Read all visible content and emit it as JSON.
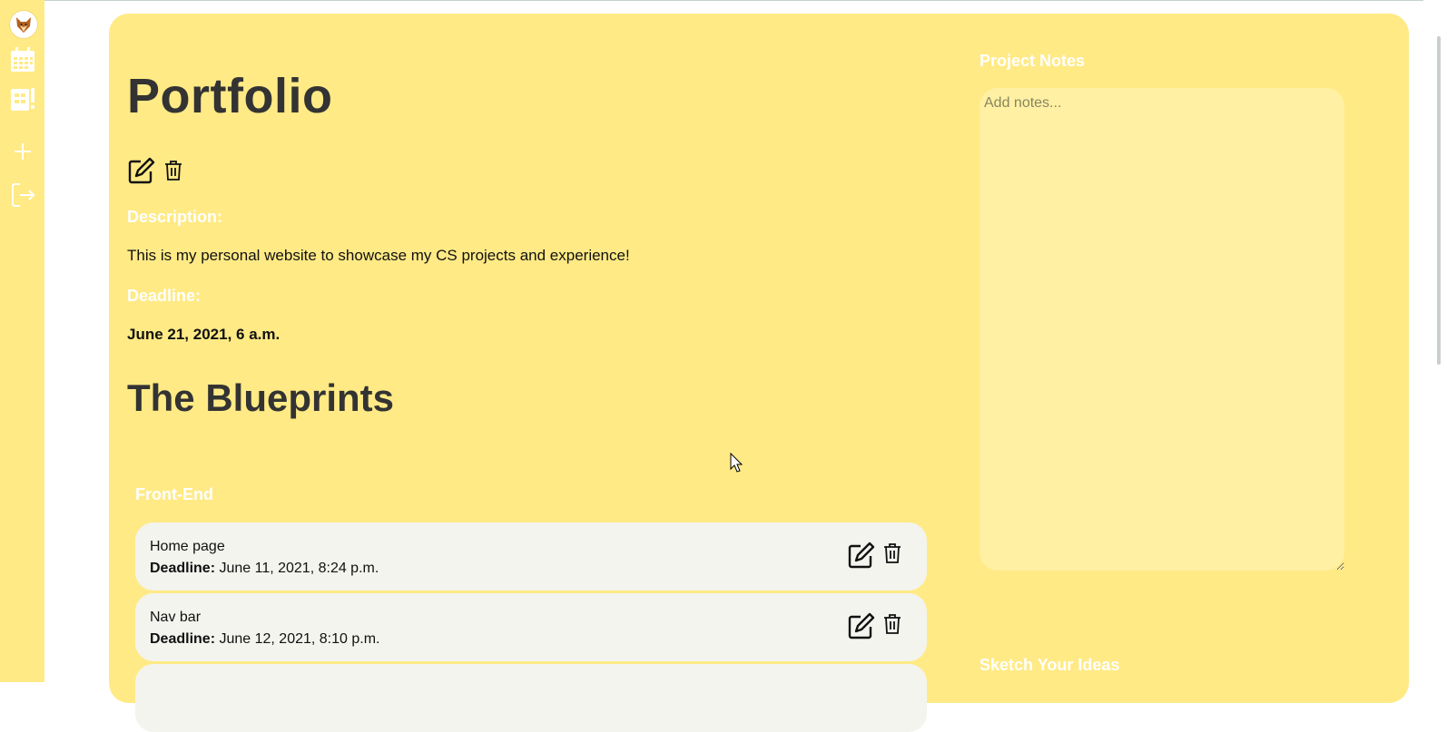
{
  "sidebar": {
    "items": [
      {
        "name": "avatar"
      },
      {
        "name": "calendar-icon"
      },
      {
        "name": "projects-icon"
      },
      {
        "name": "add-icon"
      },
      {
        "name": "logout-icon"
      }
    ]
  },
  "project": {
    "title": "Portfolio",
    "description_label": "Description:",
    "description": "This is my personal website to showcase my CS projects and experience!",
    "deadline_label": "Deadline:",
    "deadline": "June 21, 2021, 6 a.m."
  },
  "blueprints": {
    "title": "The Blueprints",
    "group": "Front-End",
    "tasks": [
      {
        "name": "Home page",
        "deadline_label": "Deadline:",
        "deadline": "June 11, 2021, 8:24 p.m."
      },
      {
        "name": "Nav bar",
        "deadline_label": "Deadline:",
        "deadline": "June 12, 2021, 8:10 p.m."
      }
    ]
  },
  "notes": {
    "label": "Project Notes",
    "placeholder": "Add notes...",
    "sketch_label": "Sketch Your Ideas"
  },
  "colors": {
    "accent": "#ffea85",
    "card": "#f3f4ee",
    "notes_bg": "#fff0a3",
    "heading": "#333333",
    "label_text": "#ffffff"
  }
}
